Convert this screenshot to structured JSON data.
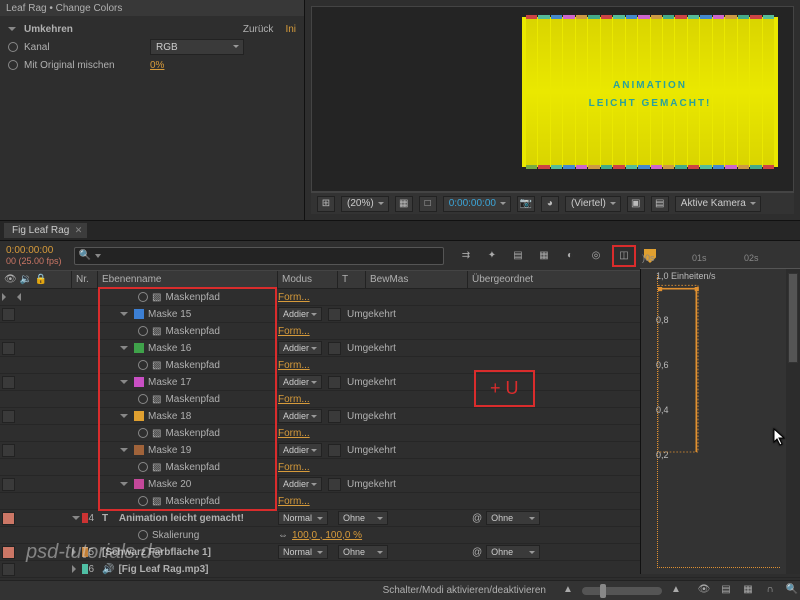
{
  "effect": {
    "breadcrumb": "Leaf Rag • Change Colors",
    "title": "Umkehren",
    "back": "Zurück",
    "ini": "Ini",
    "channel_label": "Kanal",
    "channel_value": "RGB",
    "blend_label": "Mit Original mischen",
    "blend_value": "0%"
  },
  "preview": {
    "text1": "ANIMATION",
    "text2": "LEICHT GEMACHT!",
    "zoom": "(20%)",
    "time": "0:00:00:00",
    "quality": "(Viertel)",
    "camera": "Aktive Kamera"
  },
  "timeline": {
    "tab": "Fig Leaf Rag",
    "timecode": "0:00:00:00",
    "fps": "00 (25.00 fps)",
    "search_placeholder": "",
    "cols": {
      "nr": "Nr.",
      "name": "Ebenenname",
      "mode": "Modus",
      "t": "T",
      "trk": "BewMas",
      "parent": "Übergeordnet"
    },
    "ruler": {
      "t0": ")0s",
      "t1": "01s",
      "t2": "02s"
    },
    "graph_title": "1,0 Einheiten/s",
    "gl08": "0,8",
    "gl06": "0,6",
    "gl04": "0,4",
    "gl02": "0,2",
    "prop_maskpath": "Maskenpfad",
    "prop_form": "Form...",
    "mode_add": "Addier",
    "inverted": "Umgekehrt",
    "mask_labels": {
      "m15": "Maske 15",
      "m16": "Maske 16",
      "m17": "Maske 17",
      "m18": "Maske 18",
      "m19": "Maske 19",
      "m20": "Maske 20"
    },
    "layer_anim": {
      "nr": "4",
      "name": "Animation leicht gemacht!",
      "scale_label": "Skalierung",
      "scale_value": "100,0 , 100,0 %",
      "mode": "Normal",
      "trk": "Ohne",
      "parent": "Ohne"
    },
    "layer_bg": {
      "nr": "5",
      "name": "[Schwarz Farbfläche 1]",
      "mode": "Normal",
      "trk": "Ohne",
      "parent": "Ohne"
    },
    "layer_audio": {
      "nr": "6",
      "name": "[Fig Leaf Rag.mp3]"
    },
    "footer_label": "Schalter/Modi aktivieren/deaktivieren"
  },
  "annotation": "+ U",
  "watermark": "psd-tutorials.de"
}
